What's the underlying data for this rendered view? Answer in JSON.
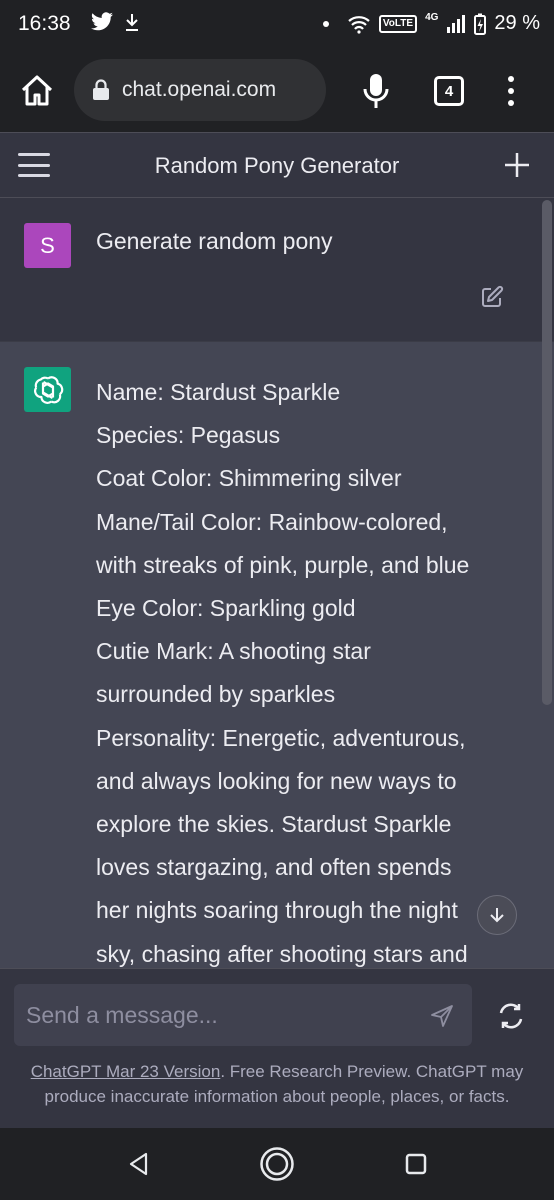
{
  "status_bar": {
    "time": "16:38",
    "network": "4G",
    "volte": "VoLTE",
    "battery": "29 %"
  },
  "browser": {
    "url": "chat.openai.com",
    "tab_count": "4"
  },
  "app": {
    "title": "Random Pony Generator"
  },
  "conversation": {
    "user_avatar_letter": "S",
    "user_message": "Generate random pony",
    "assistant_lines": [
      "Name: Stardust Sparkle",
      "Species: Pegasus",
      "Coat Color: Shimmering silver",
      "Mane/Tail Color: Rainbow-colored,",
      "with streaks of pink, purple, and blue",
      "Eye Color: Sparkling gold",
      "Cutie Mark: A shooting star",
      "surrounded by sparkles",
      "Personality: Energetic, adventurous,",
      "and always looking for new ways to",
      "explore the skies. Stardust Sparkle",
      "loves stargazing, and often spends",
      "her nights soaring through the night",
      "sky, chasing after shooting stars and"
    ]
  },
  "input": {
    "placeholder": "Send a message..."
  },
  "disclaimer": {
    "link_text": "ChatGPT Mar 23 Version",
    "text": ". Free Research Preview. ChatGPT may produce inaccurate information about people, places, or facts."
  },
  "colors": {
    "user_avatar": "#ab47bc",
    "assistant_avatar": "#10a37f",
    "background": "#343541",
    "assistant_bg": "#444654"
  }
}
